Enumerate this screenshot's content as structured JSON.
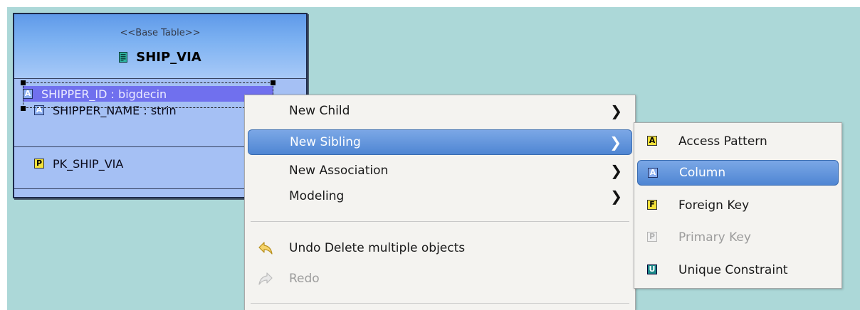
{
  "diagram": {
    "table": {
      "stereotype": "<<Base Table>>",
      "name": "SHIP_VIA",
      "columns": [
        {
          "text": "SHIPPER_ID : bigdecin",
          "badge": "A"
        },
        {
          "text": "SHIPPER_NAME : strin",
          "badge": "A"
        }
      ],
      "keys": [
        {
          "text": "PK_SHIP_VIA",
          "badge": "P"
        }
      ]
    }
  },
  "context_menu": {
    "items": [
      {
        "label": "New Child",
        "arrow": "❯"
      },
      {
        "label": "New Sibling",
        "arrow": "❯"
      },
      {
        "label": "New Association",
        "arrow": "❯"
      },
      {
        "label": "Modeling",
        "arrow": "❯"
      },
      {
        "label": "Undo Delete multiple objects"
      },
      {
        "label": "Redo"
      }
    ]
  },
  "submenu": {
    "items": [
      {
        "label": "Access Pattern",
        "badge": "A"
      },
      {
        "label": "Column",
        "badge": "A"
      },
      {
        "label": "Foreign Key",
        "badge": "F"
      },
      {
        "label": "Primary Key",
        "badge": "P"
      },
      {
        "label": "Unique Constraint",
        "badge": "U"
      }
    ]
  },
  "colors": {
    "canvas": "#acd8d8",
    "highlight": "#4f86d3",
    "selected_row": "#7070ee"
  },
  "icons": {
    "table": "table-icon",
    "undo": "undo-arrow-icon",
    "redo": "redo-arrow-icon",
    "submenu_arrow": "chevron-right-icon"
  }
}
